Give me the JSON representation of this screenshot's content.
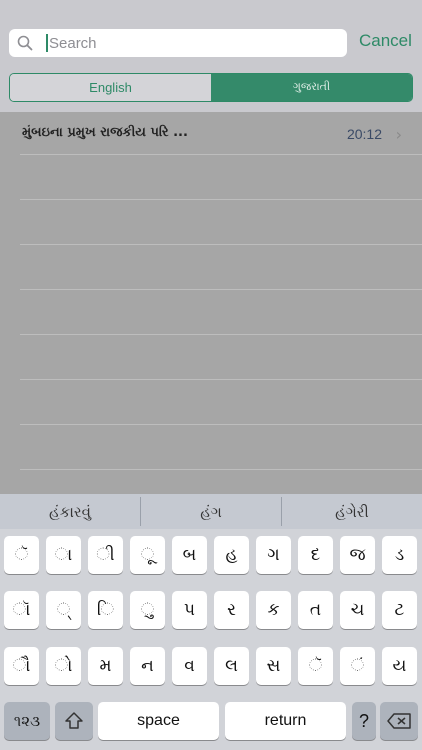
{
  "search": {
    "placeholder": "Search",
    "cancel_label": "Cancel"
  },
  "segments": {
    "english": "English",
    "gujarati": "ગુજરાતી",
    "selected": "gujarati"
  },
  "results": [
    {
      "title": "મુંબઇના પ્રમુખ રાજકીય પરિ ...",
      "time": "20:12"
    }
  ],
  "suggestions": [
    "હંકારવું",
    "હંગ",
    "હંગેરી"
  ],
  "keyboard": {
    "row1": [
      "ૅ",
      "ા",
      "ી",
      "ૂ",
      "બ",
      "હ",
      "ગ",
      "દ",
      "જ",
      "ડ"
    ],
    "row2": [
      "ૉ",
      "્",
      "િ",
      "ુ",
      "પ",
      "ર",
      "ક",
      "ત",
      "ચ",
      "ટ"
    ],
    "row3": [
      "ૌ",
      "ો",
      "મ",
      "ન",
      "વ",
      "લ",
      "સ",
      "ૅ",
      "ં",
      "ય"
    ],
    "numbers_label": "૧૨૩",
    "space_label": "space",
    "return_label": "return",
    "question_label": "?"
  },
  "colors": {
    "accent": "#2e8a67"
  }
}
